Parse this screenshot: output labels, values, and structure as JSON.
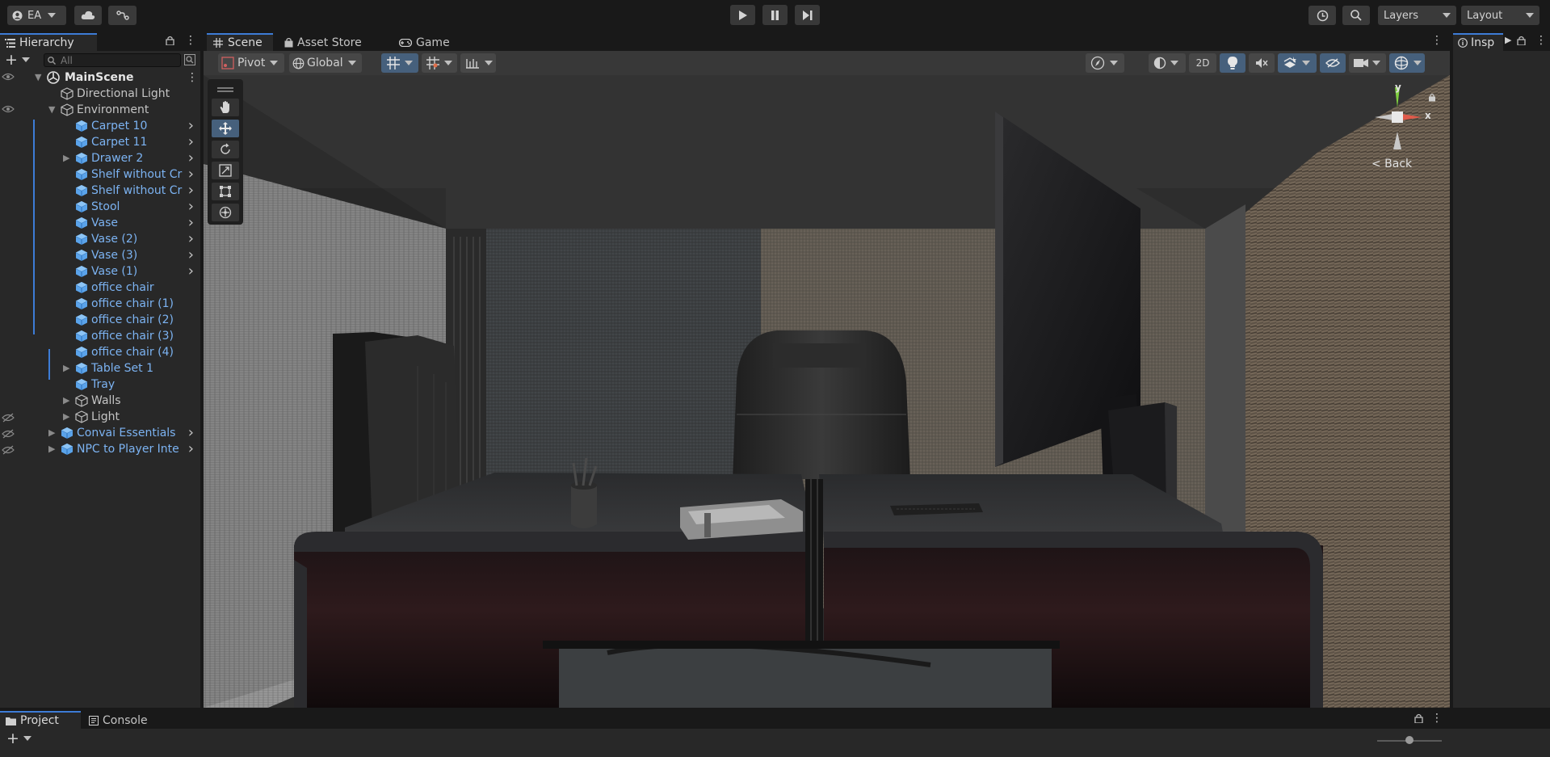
{
  "toolbar": {
    "account_label": "EA",
    "layers_label": "Layers",
    "layout_label": "Layout"
  },
  "hierarchy": {
    "tab_label": "Hierarchy",
    "search_placeholder": "All",
    "scene_name": "MainScene",
    "items": [
      {
        "label": "Directional Light",
        "depth": 1,
        "prefab": false,
        "fold": false,
        "chevron": false
      },
      {
        "label": "Environment",
        "depth": 1,
        "prefab": false,
        "fold": "open",
        "chevron": false
      },
      {
        "label": "Carpet 10",
        "depth": 2,
        "prefab": true,
        "fold": false,
        "chevron": true
      },
      {
        "label": "Carpet 11",
        "depth": 2,
        "prefab": true,
        "fold": false,
        "chevron": true
      },
      {
        "label": "Drawer 2",
        "depth": 2,
        "prefab": true,
        "fold": "closed",
        "chevron": true
      },
      {
        "label": "Shelf without Cr",
        "depth": 2,
        "prefab": true,
        "fold": false,
        "chevron": true
      },
      {
        "label": "Shelf without Cr",
        "depth": 2,
        "prefab": true,
        "fold": false,
        "chevron": true
      },
      {
        "label": "Stool",
        "depth": 2,
        "prefab": true,
        "fold": false,
        "chevron": true
      },
      {
        "label": "Vase",
        "depth": 2,
        "prefab": true,
        "fold": false,
        "chevron": true
      },
      {
        "label": "Vase (2)",
        "depth": 2,
        "prefab": true,
        "fold": false,
        "chevron": true
      },
      {
        "label": "Vase (3)",
        "depth": 2,
        "prefab": true,
        "fold": false,
        "chevron": true
      },
      {
        "label": "Vase (1)",
        "depth": 2,
        "prefab": true,
        "fold": false,
        "chevron": true
      },
      {
        "label": "office chair",
        "depth": 2,
        "prefab": true,
        "fold": false,
        "chevron": false
      },
      {
        "label": "office chair (1)",
        "depth": 2,
        "prefab": true,
        "fold": false,
        "chevron": false
      },
      {
        "label": "office chair (2)",
        "depth": 2,
        "prefab": true,
        "fold": false,
        "chevron": false
      },
      {
        "label": "office chair (3)",
        "depth": 2,
        "prefab": true,
        "fold": false,
        "chevron": false
      },
      {
        "label": "office chair (4)",
        "depth": 2,
        "prefab": true,
        "fold": false,
        "chevron": false
      },
      {
        "label": "Table Set 1",
        "depth": 2,
        "prefab": true,
        "fold": "closed",
        "chevron": false
      },
      {
        "label": "Tray",
        "depth": 2,
        "prefab": true,
        "fold": false,
        "chevron": false
      },
      {
        "label": "Walls",
        "depth": 2,
        "prefab": false,
        "fold": "closed",
        "chevron": false
      },
      {
        "label": "Light",
        "depth": 2,
        "prefab": false,
        "fold": "closed",
        "chevron": false
      },
      {
        "label": "Convai Essentials",
        "depth": 1,
        "prefab": true,
        "fold": "closed",
        "chevron": true
      },
      {
        "label": "NPC to Player Inte",
        "depth": 1,
        "prefab": true,
        "fold": "closed",
        "chevron": true
      }
    ]
  },
  "scene": {
    "tabs": [
      {
        "label": "Scene",
        "icon": "scene-grid-icon"
      },
      {
        "label": "Asset Store",
        "icon": "bag-icon"
      },
      {
        "label": "Game",
        "icon": "gamepad-icon"
      }
    ],
    "pivot_label": "Pivot",
    "global_label": "Global",
    "mode_2d_label": "2D",
    "gizmo_back_label": "< Back",
    "axis_x": "x",
    "axis_y": "y"
  },
  "inspector": {
    "tab_label": "Insp"
  },
  "bottom": {
    "tabs": [
      {
        "label": "Project",
        "icon": "folder-icon"
      },
      {
        "label": "Console",
        "icon": "console-icon"
      }
    ]
  },
  "colors": {
    "accent": "#3d7cd6",
    "prefab_text": "#7cb3f2",
    "panel_bg": "#282828",
    "toolbar_bg": "#191919"
  }
}
